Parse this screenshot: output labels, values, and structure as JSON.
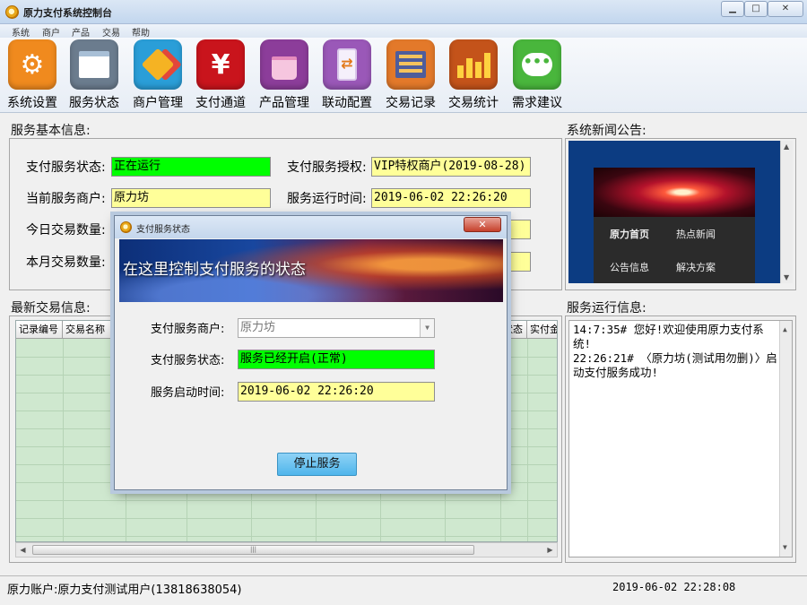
{
  "window": {
    "title": "原力支付系统控制台"
  },
  "menu": [
    "系统",
    "商户",
    "产品",
    "交易",
    "帮助"
  ],
  "toolbar": [
    {
      "label": "系统设置",
      "icon": "gear-icon",
      "color": "#f08a1e"
    },
    {
      "label": "服务状态",
      "icon": "window-icon",
      "color": "#6b7c8e"
    },
    {
      "label": "商户管理",
      "icon": "tags-icon",
      "color": "#2a9ed8"
    },
    {
      "label": "支付通道",
      "icon": "yen-icon",
      "color": "#c9141c"
    },
    {
      "label": "产品管理",
      "icon": "shopping-bag-icon",
      "color": "#8c3d9a"
    },
    {
      "label": "联动配置",
      "icon": "phone-transfer-icon",
      "color": "#9a58b8"
    },
    {
      "label": "交易记录",
      "icon": "list-icon",
      "color": "#e3792a"
    },
    {
      "label": "交易统计",
      "icon": "bar-chart-icon",
      "color": "#c4531a"
    },
    {
      "label": "需求建议",
      "icon": "chat-bubble-icon",
      "color": "#49b63c"
    }
  ],
  "service_info": {
    "title": "服务基本信息:",
    "status_label": "支付服务状态:",
    "status_value": "正在运行",
    "auth_label": "支付服务授权:",
    "auth_value": "VIP特权商户(2019-08-28)",
    "merchant_label": "当前服务商户:",
    "merchant_value": "原力坊",
    "runtime_label": "服务运行时间:",
    "runtime_value": "2019-06-02 22:26:20",
    "today_label": "今日交易数量:",
    "month_label": "本月交易数量:"
  },
  "transactions": {
    "title": "最新交易信息:",
    "columns": [
      "记录编号",
      "交易名称",
      "状态",
      "实付金"
    ]
  },
  "news": {
    "title": "系统新闻公告:",
    "items": [
      "原力首页",
      "热点新闻",
      "公告信息",
      "解决方案"
    ]
  },
  "log": {
    "title": "服务运行信息:",
    "lines": [
      "14:7:35# 您好!欢迎使用原力支付系统!",
      "22:26:21# 〈原力坊(测试用勿删)〉启动支付服务成功!"
    ]
  },
  "statusbar": {
    "account": "原力账户:原力支付测试用户(13818638054)",
    "time": "2019-06-02 22:28:08"
  },
  "dialog": {
    "title": "支付服务状态",
    "banner": "在这里控制支付服务的状态",
    "merchant_label": "支付服务商户:",
    "merchant_value": "原力坊",
    "status_label": "支付服务状态:",
    "status_value": "服务已经开启(正常)",
    "start_label": "服务启动时间:",
    "start_value": "2019-06-02 22:26:20",
    "stop_button": "停止服务"
  }
}
